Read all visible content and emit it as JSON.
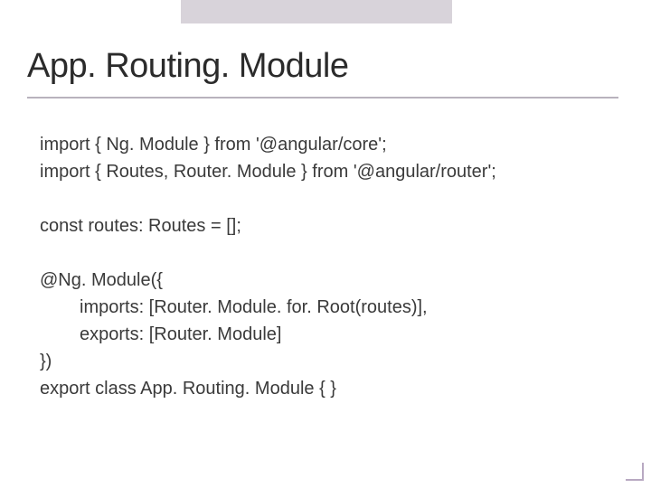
{
  "title": "App. Routing. Module",
  "code": {
    "l1": "import { Ng. Module } from '@angular/core';",
    "l2": "import { Routes, Router. Module } from '@angular/router';",
    "l3": "const routes: Routes = [];",
    "l4": "@Ng. Module({",
    "l5": "imports: [Router. Module. for. Root(routes)],",
    "l6": "exports: [Router. Module]",
    "l7": "})",
    "l8": "export class App. Routing. Module { }"
  }
}
